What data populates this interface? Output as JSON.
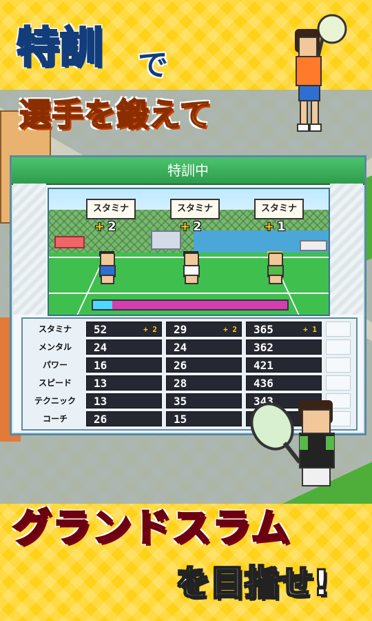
{
  "headline": {
    "line1": "特訓",
    "line1_particle": "で",
    "line2": "選手を鍛えて",
    "bottom_title": "グランドスラム",
    "bottom_sub": "を目指せ!"
  },
  "panel": {
    "title": "特訓中",
    "scene_tags": [
      {
        "label": "スタミナ",
        "gain": "2"
      },
      {
        "label": "スタミナ",
        "gain": "2"
      },
      {
        "label": "スタミナ",
        "gain": "1"
      }
    ],
    "gauge_fraction": 0.1,
    "table": {
      "rows": [
        {
          "label": "スタミナ",
          "values": [
            "52",
            "29",
            "365"
          ],
          "bonus": [
            "+ 2",
            "+ 2",
            "+ 1"
          ]
        },
        {
          "label": "メンタル",
          "values": [
            "24",
            "24",
            "362"
          ],
          "bonus": [
            "",
            "",
            ""
          ]
        },
        {
          "label": "パワー",
          "values": [
            "16",
            "26",
            "421"
          ],
          "bonus": [
            "",
            "",
            ""
          ]
        },
        {
          "label": "スピード",
          "values": [
            "13",
            "28",
            "436"
          ],
          "bonus": [
            "",
            "",
            ""
          ]
        },
        {
          "label": "テクニック",
          "values": [
            "13",
            "35",
            "343"
          ],
          "bonus": [
            "",
            "",
            ""
          ]
        },
        {
          "label": "コーチ",
          "values": [
            "26",
            "15",
            ""
          ],
          "bonus": [
            "",
            "",
            ""
          ]
        }
      ]
    }
  },
  "colors": {
    "background": "#ffd21a",
    "header_green": "#2e9d4b",
    "title_red": "#ff3b5e",
    "stat_cell": "#252830"
  }
}
